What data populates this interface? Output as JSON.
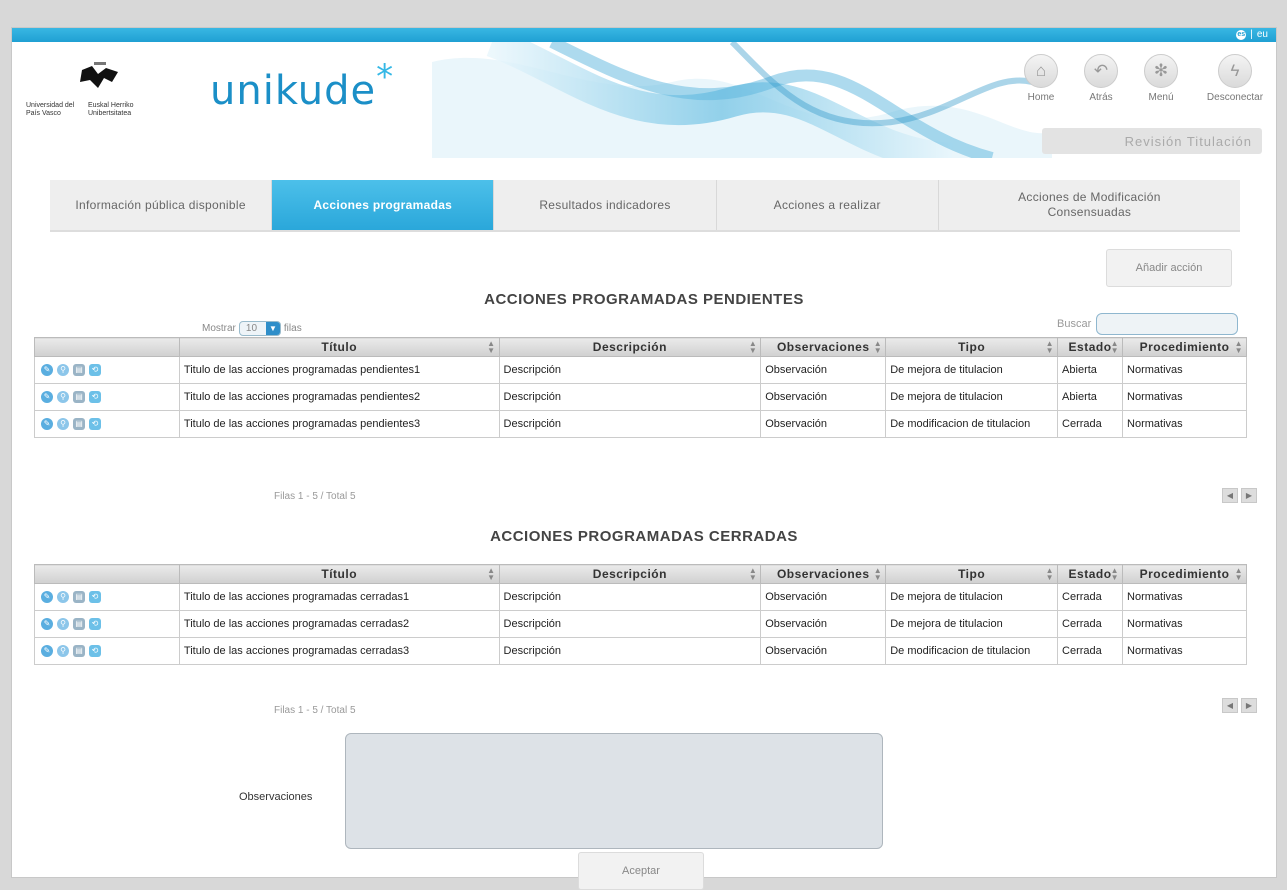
{
  "lang": {
    "es": "es",
    "separator": "|",
    "eu": "eu"
  },
  "university": {
    "line1": "Universidad del País Vasco",
    "line2": "Euskal Herriko Unibertsitatea"
  },
  "brand": {
    "name": "unikude",
    "star": "*"
  },
  "nav": [
    {
      "label": "Home",
      "icon": "home-icon",
      "glyph": "⌂"
    },
    {
      "label": "Atrás",
      "icon": "back-icon",
      "glyph": "↶"
    },
    {
      "label": "Menú",
      "icon": "menu-icon",
      "glyph": "✻"
    },
    {
      "label": "Desconectar",
      "icon": "disconnect-icon",
      "glyph": "ϟ"
    }
  ],
  "revision": "Revisión Titulación",
  "tabs": [
    {
      "label": "Información pública disponible",
      "active": false
    },
    {
      "label": "Acciones programadas",
      "active": true
    },
    {
      "label": "Resultados indicadores",
      "active": false
    },
    {
      "label": "Acciones a realizar",
      "active": false
    },
    {
      "label": "Acciones de Modificación Consensuadas",
      "active": false
    }
  ],
  "add_action": "Añadir acción",
  "length_menu": {
    "before": "Mostrar",
    "value": "10",
    "after": "filas"
  },
  "search": {
    "label": "Buscar"
  },
  "columns": [
    "Título",
    "Descripción",
    "Observaciones",
    "Tipo",
    "Estado",
    "Procedimiento"
  ],
  "pending": {
    "title": "ACCIONES PROGRAMADAS PENDIENTES",
    "rows": [
      [
        "Titulo de las acciones programadas pendientes1",
        "Descripción",
        "Observación",
        "De mejora de titulacion",
        "Abierta",
        "Normativas"
      ],
      [
        "Titulo de las acciones programadas pendientes2",
        "Descripción",
        "Observación",
        "De mejora de titulacion",
        "Abierta",
        "Normativas"
      ],
      [
        "Titulo de las acciones programadas pendientes3",
        "Descripción",
        "Observación",
        "De modificacion de titulacion",
        "Cerrada",
        "Normativas"
      ]
    ],
    "info": "Filas 1 - 5 / Total 5"
  },
  "closed": {
    "title": "ACCIONES PROGRAMADAS CERRADAS",
    "rows": [
      [
        "Titulo de las acciones programadas cerradas1",
        "Descripción",
        "Observación",
        "De mejora de titulacion",
        "Cerrada",
        "Normativas"
      ],
      [
        "Titulo de las acciones programadas cerradas2",
        "Descripción",
        "Observación",
        "De mejora de titulacion",
        "Cerrada",
        "Normativas"
      ],
      [
        "Titulo de las acciones programadas cerradas3",
        "Descripción",
        "Observación",
        "De modificacion de titulacion",
        "Cerrada",
        "Normativas"
      ]
    ],
    "info": "Filas 1 - 5 / Total 5"
  },
  "observaciones_label": "Observaciones",
  "accept": "Aceptar",
  "row_icons": [
    {
      "name": "edit-icon",
      "glyph": "✎",
      "cls": "a"
    },
    {
      "name": "view-icon",
      "glyph": "⚲",
      "cls": "b"
    },
    {
      "name": "document-icon",
      "glyph": "▤",
      "cls": "c"
    },
    {
      "name": "refresh-icon",
      "glyph": "⟲",
      "cls": "d"
    }
  ]
}
